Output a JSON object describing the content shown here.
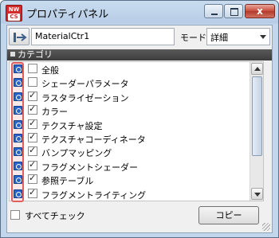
{
  "window": {
    "app_icon_line1": "NW",
    "app_icon_line2": "CS",
    "title": "プロパティパネル",
    "close_glyph": "x"
  },
  "header": {
    "name_value": "MaterialCtr1",
    "mode_label": "モード：",
    "mode_value": "詳細"
  },
  "category": {
    "label": "カテゴリ"
  },
  "list": {
    "items": [
      {
        "label": "全般",
        "checked": false
      },
      {
        "label": "シェーダーパラメータ",
        "checked": false
      },
      {
        "label": "ラスタライゼーション",
        "checked": true
      },
      {
        "label": "カラー",
        "checked": true
      },
      {
        "label": "テクスチャ設定",
        "checked": true
      },
      {
        "label": "テクスチャコーディネータ",
        "checked": true
      },
      {
        "label": "バンプマッピング",
        "checked": true
      },
      {
        "label": "フラグメントシェーダー",
        "checked": true
      },
      {
        "label": "参照テーブル",
        "checked": true
      },
      {
        "label": "フラグメントライティング",
        "checked": true
      }
    ]
  },
  "footer": {
    "check_all_label": "すべてチェック",
    "copy_button": "コピー"
  }
}
